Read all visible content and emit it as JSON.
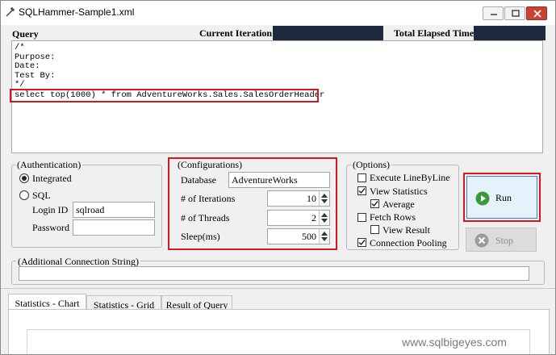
{
  "window": {
    "title": "SQLHammer-Sample1.xml"
  },
  "query_section": {
    "label": "Query",
    "current_iteration_label": "Current Iteration",
    "current_iteration_value": "",
    "elapsed_label": "Total Elapsed Time",
    "elapsed_value": "",
    "lines": [
      "/*",
      "Purpose:",
      "Date:",
      "Test By:",
      "*/",
      "select top(1000) * from AdventureWorks.Sales.SalesOrderHeader"
    ]
  },
  "authentication": {
    "legend": "(Authentication)",
    "integrated_label": "Integrated",
    "integrated_selected": true,
    "sql_label": "SQL",
    "sql_selected": false,
    "login_label": "Login ID",
    "login_value": "sqlroad",
    "password_label": "Password",
    "password_value": ""
  },
  "configurations": {
    "legend": "(Configurations)",
    "database_label": "Database",
    "database_value": "AdventureWorks",
    "iterations_label": "# of Iterations",
    "iterations_value": "10",
    "threads_label": "# of Threads",
    "threads_value": "2",
    "sleep_label": "Sleep(ms)",
    "sleep_value": "500"
  },
  "options": {
    "legend": "(Options)",
    "items": [
      {
        "label": "Execute LineByLine",
        "checked": false
      },
      {
        "label": "View Statistics",
        "checked": true
      },
      {
        "label": "Average",
        "checked": true
      },
      {
        "label": "Fetch Rows",
        "checked": false
      },
      {
        "label": "View Result",
        "checked": false
      },
      {
        "label": "Connection Pooling",
        "checked": true
      }
    ]
  },
  "actions": {
    "run_label": "Run",
    "stop_label": "Stop"
  },
  "additional": {
    "legend": "(Additional Connection String)",
    "value": ""
  },
  "tabs": [
    {
      "label": "Statistics - Chart",
      "active": true
    },
    {
      "label": "Statistics - Grid",
      "active": false
    },
    {
      "label": "Result of Query",
      "active": false
    }
  ],
  "watermark": "www.sqlbigeyes.com",
  "colors": {
    "highlight_red": "#d7161d",
    "dark_field": "#1e2a3e",
    "run_icon_green": "#3a9a3a"
  }
}
